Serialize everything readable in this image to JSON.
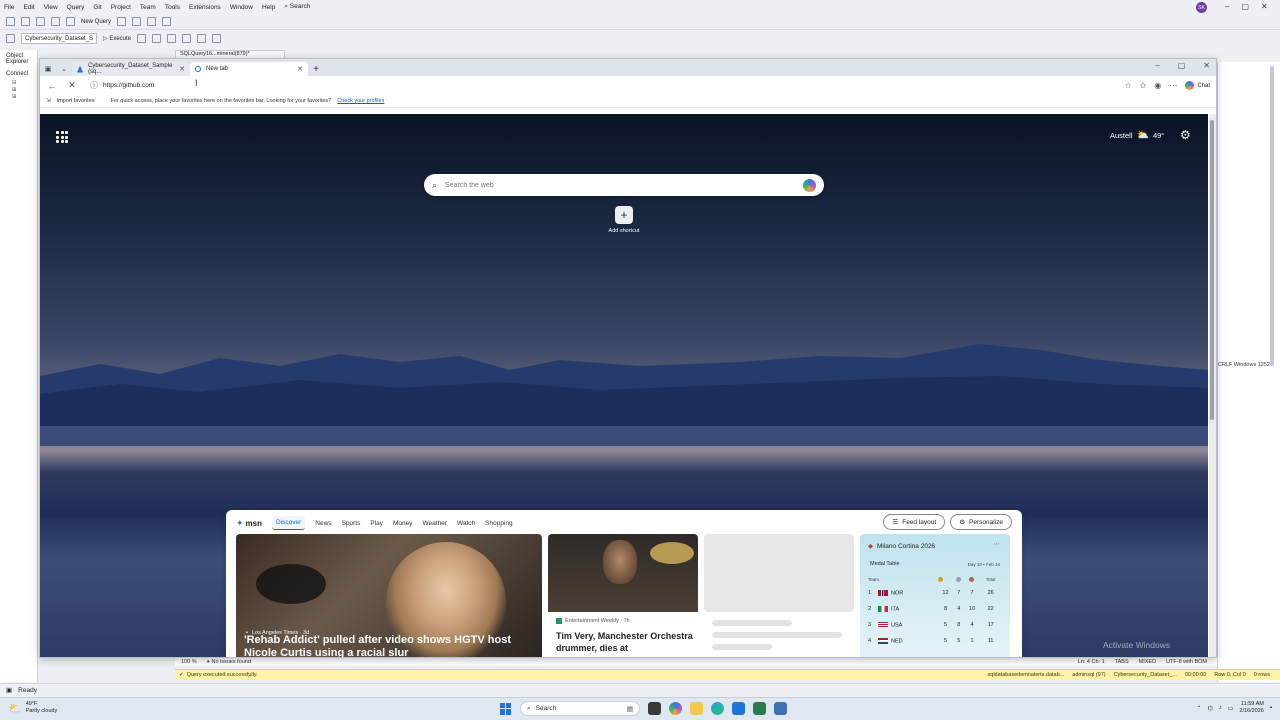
{
  "ssms": {
    "menu": [
      "File",
      "Edit",
      "View",
      "Query",
      "Git",
      "Project",
      "Team",
      "Tools",
      "Extensions",
      "Window",
      "Help",
      "Search"
    ],
    "new_query": "New Query",
    "database_selector": "Cybersecurity_Dataset_S",
    "execute": "Execute",
    "object_explorer_title": "Object Explorer",
    "connect": "Connect",
    "doc_tab": "SQLQuery16...mineral(879)*",
    "avatar_initials": "SK",
    "right_panel_info": "CRLF   Windows 1252",
    "editor_status": {
      "zoom": "100 %",
      "issues": "No issues found",
      "position": "Ln: 4   Ch: 1",
      "tabs": "TABS",
      "mixed": "MIXED",
      "encoding": "UTF-8 with BOM"
    },
    "query_status": {
      "message": "Query executed successfully.",
      "server": "sqldatabasedemoalerts.datab...",
      "user": "adminsql (97)",
      "db": "Cybersecurity_Dataset_...",
      "time": "00:00:00",
      "rows": "Row 0, Col 0",
      "row_count": "0 rows"
    },
    "status_ready": "Ready"
  },
  "edge": {
    "tabs": [
      {
        "label": "Cybersecurity_Dataset_Sample (sq...",
        "active": false
      },
      {
        "label": "New tab",
        "active": true
      }
    ],
    "url": "https://github.com",
    "chat_label": "Chat",
    "favbar": {
      "import": "Import favorites",
      "message": "For quick access, place your favorites here on the favorites bar. Looking for your favorites?",
      "link": "Check your profiles"
    }
  },
  "ntp": {
    "weather_city": "Austell",
    "weather_temp": "49°",
    "search_placeholder": "Search the web",
    "add_shortcut": "Add shortcut",
    "watermark": "Activate Windows"
  },
  "msn": {
    "logo": "msn",
    "nav": [
      "Discover",
      "News",
      "Sports",
      "Play",
      "Money",
      "Weather",
      "Watch",
      "Shopping"
    ],
    "feed_layout": "Feed layout",
    "personalize": "Personalize",
    "main_card": {
      "source": "Los Angeles Times · 3d",
      "headline": "'Rehab Addict' pulled after video shows HGTV host Nicole Curtis using a racial slur"
    },
    "card2": {
      "source": "Entertainment Weekly · 7h",
      "headline": "Tim Very, Manchester Orchestra drummer, dies at"
    },
    "medals": {
      "title": "Milano Cortina 2026",
      "subtitle": "Medal Table",
      "day": "Day 10 • Feb 16",
      "headers": [
        "",
        "Team",
        "G",
        "S",
        "B",
        "Total"
      ],
      "rows": [
        {
          "rank": "1",
          "team": "NOR",
          "gold": "12",
          "silver": "7",
          "bronze": "7",
          "total": "26"
        },
        {
          "rank": "2",
          "team": "ITA",
          "gold": "8",
          "silver": "4",
          "bronze": "10",
          "total": "22"
        },
        {
          "rank": "3",
          "team": "USA",
          "gold": "5",
          "silver": "8",
          "bronze": "4",
          "total": "17"
        },
        {
          "rank": "4",
          "team": "NED",
          "gold": "5",
          "silver": "5",
          "bronze": "1",
          "total": "11"
        }
      ]
    }
  },
  "taskbar": {
    "weather_temp": "49°F",
    "weather_desc": "Partly cloudy",
    "search": "Search",
    "time": "11:59 AM",
    "date": "2/16/2026"
  },
  "colors": {
    "edge_accent": "#0f6cbd",
    "query_status_bg": "#fff3a8",
    "taskbar_bg": "#dfe7f2"
  }
}
